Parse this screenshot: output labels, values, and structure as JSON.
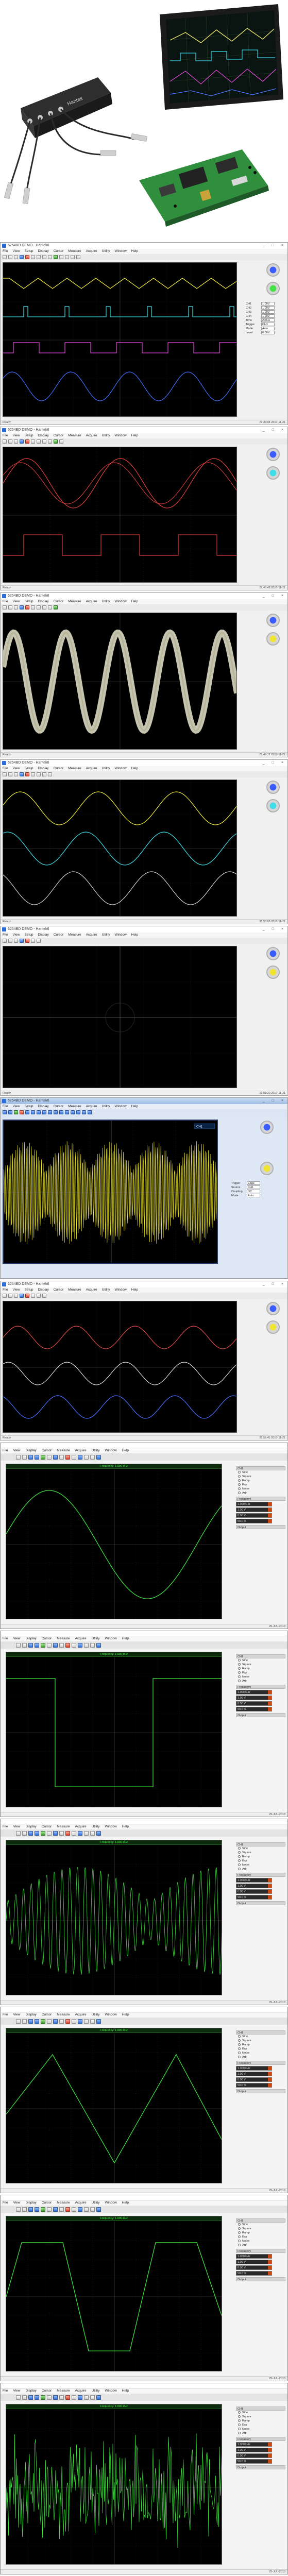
{
  "product": {
    "brand_label": "Hantek",
    "tablet_caption": ""
  },
  "win_a": {
    "title": "6254BD DEMO - Hantek6",
    "menu": [
      "File",
      "View",
      "Setup",
      "Display",
      "Cursor",
      "Measure",
      "Acquire",
      "Utility",
      "Window",
      "Help"
    ],
    "status_left": "Ready",
    "status_right": "21:49:04  2017-11-21",
    "panel": [
      {
        "label": "CH1",
        "value": "1.00V"
      },
      {
        "label": "CH2",
        "value": "1.00V"
      },
      {
        "label": "CH3",
        "value": "1.00V"
      },
      {
        "label": "CH4",
        "value": "1.00V"
      },
      {
        "label": "Time",
        "value": "200us"
      },
      {
        "label": "Trigger",
        "value": "CH1"
      },
      {
        "label": "Mode",
        "value": "Auto"
      },
      {
        "label": "Level",
        "value": "0.00V"
      }
    ]
  },
  "win_b": {
    "title": "6254BD DEMO - Hantek6",
    "status_right": "21:48:42  2017-11-21"
  },
  "win_c": {
    "title": "6254BD DEMO - Hantek6",
    "status_right": "21:49:12  2017-11-21"
  },
  "win_d": {
    "title": "6254BD DEMO - Hantek6",
    "status_right": "21:50:03  2017-11-21"
  },
  "win_e": {
    "title": "6254BD DEMO - Hantek6",
    "status_right": "21:51:20  2017-11-21"
  },
  "win_f": {
    "title": "6254BD DEMO - Hantek6",
    "readout": "CH1",
    "panel": [
      {
        "label": "Trigger",
        "value": "Edge"
      },
      {
        "label": "Source",
        "value": "CH1"
      },
      {
        "label": "Coupling",
        "value": "DC"
      },
      {
        "label": "Mode",
        "value": "Auto"
      }
    ]
  },
  "win_g": {
    "title": "6254BD DEMO - Hantek6",
    "status_right": "21:52:41  2017-11-21"
  },
  "gen": {
    "menu": [
      "File",
      "View",
      "Display",
      "Cursor",
      "Measure",
      "Acquire",
      "Utility",
      "Window",
      "Help"
    ],
    "screens": [
      {
        "freq": "Frequency: 1.000 kHz",
        "wave": "sine",
        "status": "25-JUL-2013"
      },
      {
        "freq": "Frequency: 1.000 kHz",
        "wave": "square",
        "status": "25-JUL-2013"
      },
      {
        "freq": "Frequency: 1.000 kHz",
        "wave": "am",
        "status": "25-JUL-2013"
      },
      {
        "freq": "Frequency: 1.000 kHz",
        "wave": "triangle",
        "status": "25-JUL-2013"
      },
      {
        "freq": "Frequency: 1.000 kHz",
        "wave": "trapezoid",
        "status": "25-JUL-2013"
      },
      {
        "freq": "Frequency: 1.000 kHz",
        "wave": "noise",
        "status": "25-JUL-2013"
      }
    ],
    "side": {
      "h1": "CH1",
      "opts": [
        "Sine",
        "Square",
        "Ramp",
        "Exp",
        "Noise",
        "Arb"
      ],
      "h2": "Frequency",
      "fields": [
        "1.000 kHz",
        "1.00 V",
        "0.00 V",
        "50.0 %"
      ],
      "h3": "Output"
    }
  }
}
